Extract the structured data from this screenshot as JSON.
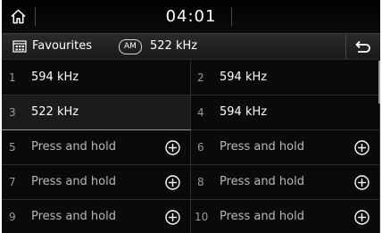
{
  "statusbar": {
    "time": "04:01",
    "home_icon": "home-icon"
  },
  "header": {
    "title": "Favourites",
    "title_icon": "favourites-list-icon",
    "band": "AM",
    "frequency": "522 kHz",
    "back_icon": "back-arrow-icon"
  },
  "presets": [
    {
      "number": "1",
      "label": "594 kHz",
      "empty": false
    },
    {
      "number": "2",
      "label": "594 kHz",
      "empty": false
    },
    {
      "number": "3",
      "label": "522 kHz",
      "empty": false,
      "selected": true
    },
    {
      "number": "4",
      "label": "594 kHz",
      "empty": false
    },
    {
      "number": "5",
      "label": "Press and hold",
      "empty": true
    },
    {
      "number": "6",
      "label": "Press and hold",
      "empty": true
    },
    {
      "number": "7",
      "label": "Press and hold",
      "empty": true
    },
    {
      "number": "8",
      "label": "Press and hold",
      "empty": true
    },
    {
      "number": "9",
      "label": "Press and hold",
      "empty": true
    },
    {
      "number": "10",
      "label": "Press and hold",
      "empty": true
    }
  ],
  "colors": {
    "background": "#0a0a0a",
    "text": "#ffffff",
    "muted": "#9a9a9a",
    "divider": "#2e2e2e"
  }
}
